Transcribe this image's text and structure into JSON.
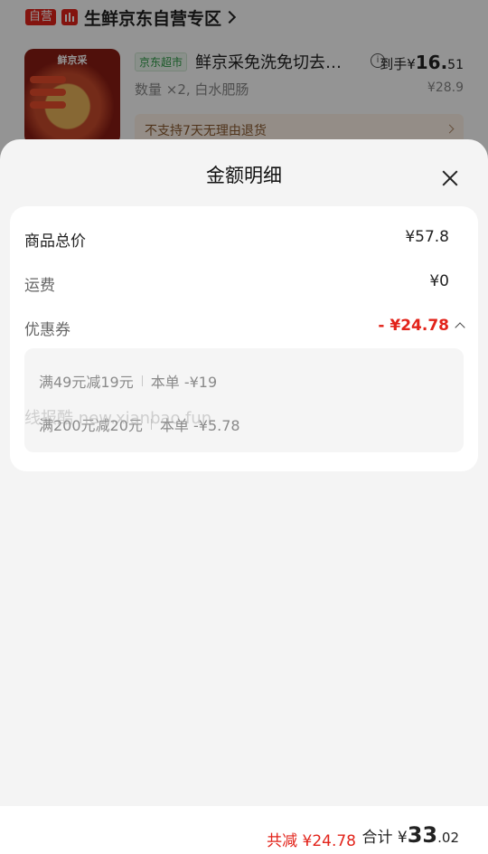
{
  "background": {
    "store": {
      "tag": "自营",
      "name": "生鲜京东自营专区",
      "logo_icon": "bar-chart-logo-icon"
    },
    "product": {
      "image_brand": "鲜京采",
      "market_tag": "京东超市",
      "title": "鲜京采免洗免切去…",
      "net_price_label": "到手¥",
      "net_price_int": "16.",
      "net_price_dec": "51",
      "quantity_spec": "数量 ×2, 白水肥肠",
      "original_price": "¥28.9",
      "return_policy": "不支持7天无理由退货"
    }
  },
  "sheet": {
    "title": "金额明细",
    "rows": {
      "goods_total_label": "商品总价",
      "goods_total_value": "¥57.8",
      "shipping_label": "运费",
      "shipping_value": "¥0",
      "coupon_label": "优惠券",
      "coupon_value": "- ¥24.78"
    },
    "coupons": [
      {
        "rule": "满49元减19元",
        "applied": "本单 -¥19"
      },
      {
        "rule": "满200元减20元",
        "applied": "本单 -¥5.78"
      }
    ],
    "watermark": "线报酷 new.xianbao.fun"
  },
  "footer": {
    "discount_text": "共减 ¥24.78",
    "total_label": "合计 ¥",
    "total_int": "33",
    "total_dec": ".02"
  },
  "colors": {
    "accent_red": "#e2231a",
    "market_green": "#2e9b47"
  }
}
